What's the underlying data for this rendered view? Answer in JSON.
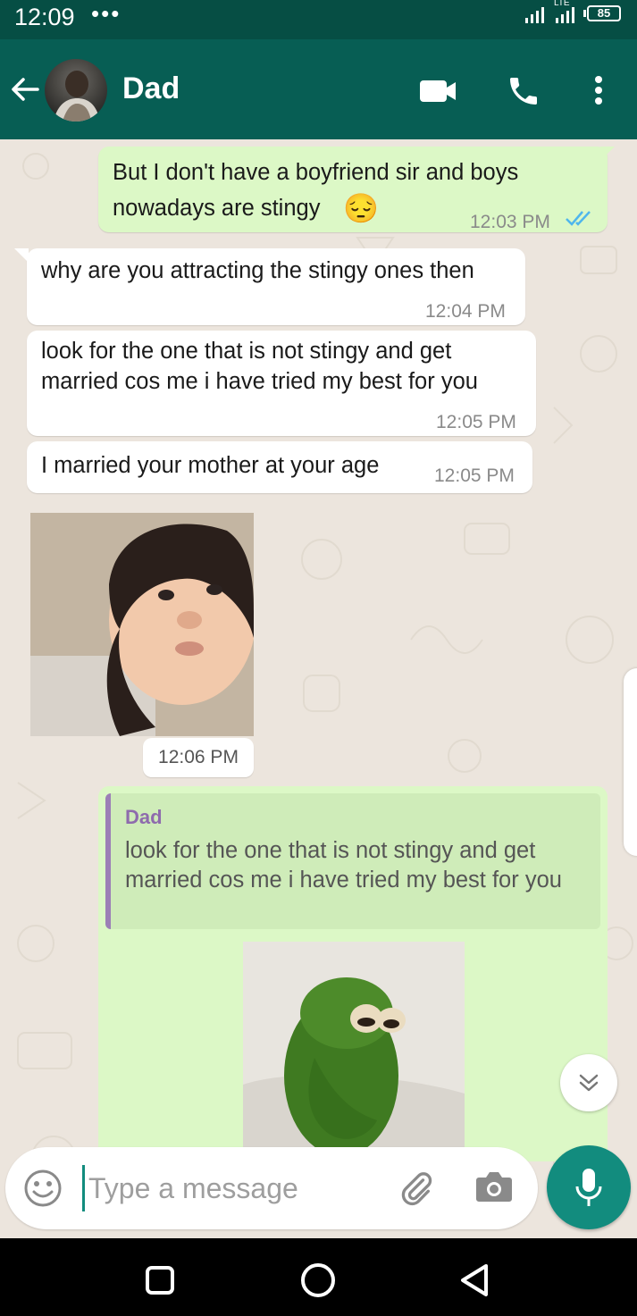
{
  "status_bar": {
    "time": "12:09",
    "dots": "•••",
    "network": "LTE",
    "battery": "85"
  },
  "header": {
    "contact_name": "Dad"
  },
  "messages": [
    {
      "direction": "out",
      "text_line1": "But I don't have a boyfriend sir and boys",
      "text_line2": "nowadays are stingy",
      "emoji": "😔",
      "time": "12:03 PM",
      "read": true
    },
    {
      "direction": "in",
      "text": "why are you attracting the stingy ones then",
      "time": "12:04 PM"
    },
    {
      "direction": "in",
      "text_line1": "look for the one that is not stingy and get",
      "text_line2": "married cos me i have tried my best for you",
      "time": "12:05 PM"
    },
    {
      "direction": "in",
      "text": "I married your mother at your age",
      "time": "12:05 PM"
    },
    {
      "direction": "in",
      "type": "image",
      "time": "12:06 PM"
    },
    {
      "direction": "out",
      "type": "reply",
      "quoted_author": "Dad",
      "quoted_text": "look for the one that is not stingy and get married cos me i have tried my best for you"
    }
  ],
  "composer": {
    "placeholder": "Type a message"
  },
  "colors": {
    "header": "#075e54",
    "status_bar": "#064e44",
    "outgoing_bubble": "#dcf8c6",
    "incoming_bubble": "#ffffff",
    "chat_background": "#ece5dd",
    "accent": "#128c7e",
    "read_ticks": "#4fb6ec"
  },
  "icons": [
    "back-arrow-icon",
    "video-call-icon",
    "phone-icon",
    "more-options-icon",
    "emoji-icon",
    "attach-icon",
    "camera-icon",
    "mic-icon",
    "double-chevron-down-icon",
    "double-check-icon"
  ]
}
